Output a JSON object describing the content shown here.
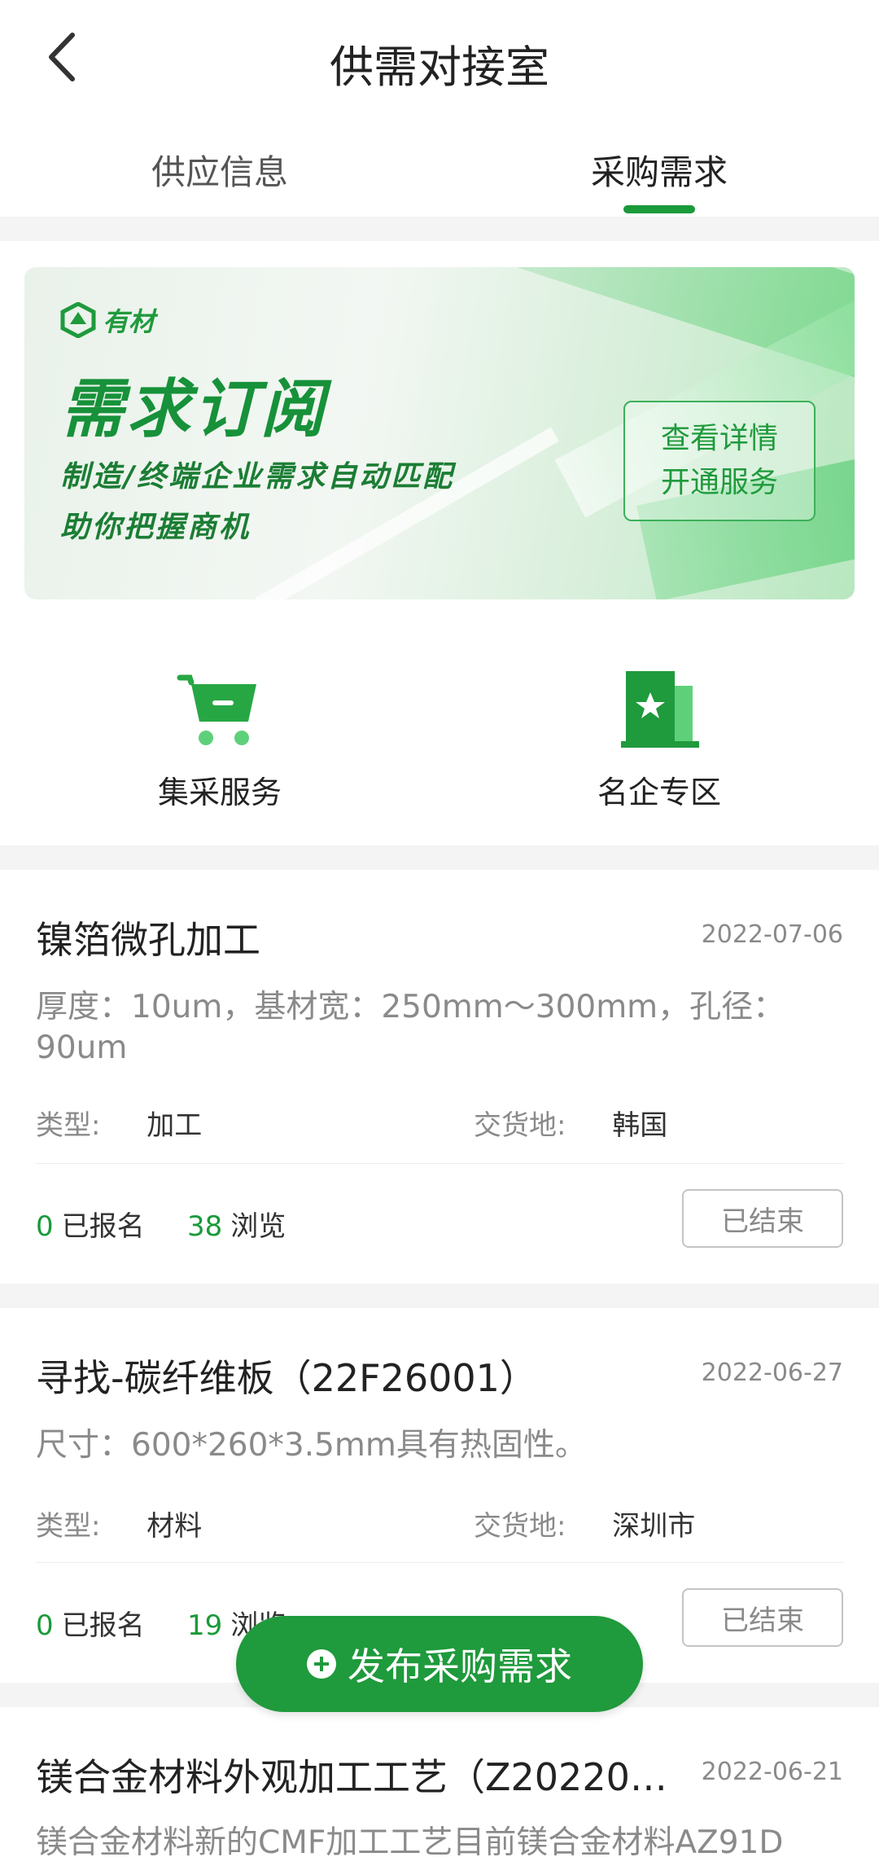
{
  "header": {
    "title": "供需对接室",
    "back_icon": "chevron-left-icon"
  },
  "tabs": [
    {
      "label": "供应信息",
      "active": false
    },
    {
      "label": "采购需求",
      "active": true
    }
  ],
  "banner": {
    "logo_text": "有材",
    "title": "需求订阅",
    "subtitle_1": "制造/终端企业需求自动匹配",
    "subtitle_2": "助你把握商机",
    "cta_line_1": "查看详情",
    "cta_line_2": "开通服务"
  },
  "quick_entries": [
    {
      "label": "集采服务",
      "icon": "cart-icon"
    },
    {
      "label": "名企专区",
      "icon": "building-star-icon"
    }
  ],
  "listings": [
    {
      "title": "镍箔微孔加工",
      "date": "2022-07-06",
      "description": "厚度：10um，基材宽：250mm～300mm，孔径：90um",
      "type_label": "类型:",
      "type_value": "加工",
      "delivery_label": "交货地:",
      "delivery_value": "韩国",
      "registered_count": "0",
      "registered_label": "已报名",
      "views_count": "38",
      "views_label": "浏览",
      "status": "已结束"
    },
    {
      "title": "寻找-碳纤维板（22F26001）",
      "date": "2022-06-27",
      "description": "尺寸：600*260*3.5mm具有热固性。",
      "type_label": "类型:",
      "type_value": "材料",
      "delivery_label": "交货地:",
      "delivery_value": "深圳市",
      "registered_count": "0",
      "registered_label": "已报名",
      "views_count": "19",
      "views_label": "浏览",
      "status": "已结束"
    },
    {
      "title": "镁合金材料外观加工工艺（Z20220…",
      "date": "2022-06-21",
      "description": "镁合金材料新的CMF加工工艺目前镁合金材料AZ91D"
    }
  ],
  "publish_button": {
    "label": "发布采购需求",
    "icon": "plus-circle-icon"
  },
  "colors": {
    "accent": "#1f9a3c",
    "muted_text": "#8a8a8a",
    "background_gap": "#f3f4f3"
  }
}
